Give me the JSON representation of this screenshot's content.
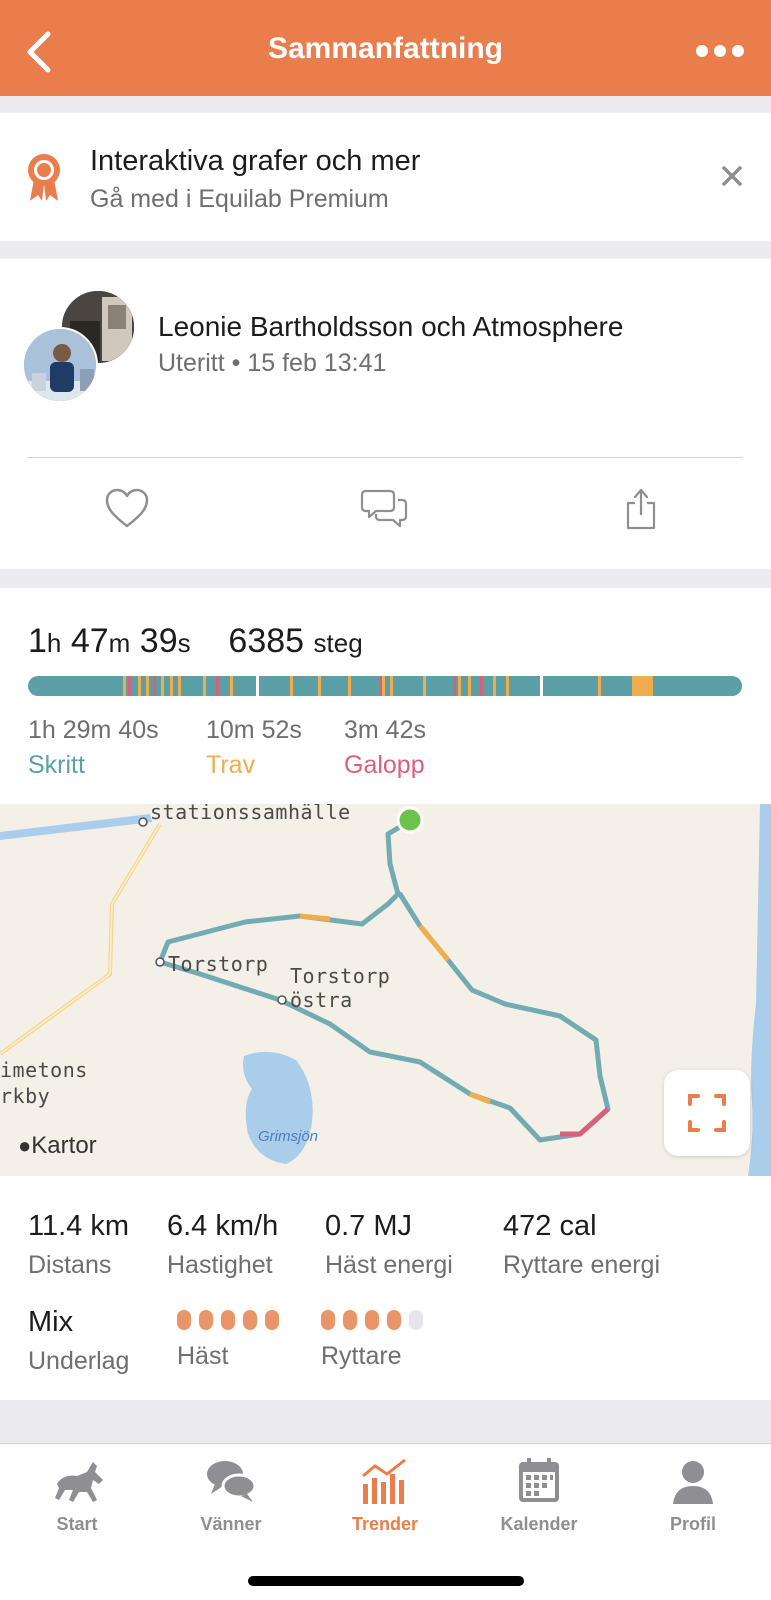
{
  "nav": {
    "title": "Sammanfattning"
  },
  "premium": {
    "title": "Interaktiva grafer och mer",
    "subtitle": "Gå med i Equilab Premium"
  },
  "activity": {
    "name": "Leonie Bartholdsson och Atmosphere",
    "type": "Uteritt",
    "separator": "•",
    "datetime": "15 feb 13:41"
  },
  "gait": {
    "total": {
      "h": "1",
      "h_unit": "h",
      "m": "47",
      "m_unit": "m",
      "s": "39",
      "s_unit": "s"
    },
    "steps": "6385",
    "steps_unit": "steg",
    "items": [
      {
        "time": "1h 29m 40s",
        "label": "Skritt",
        "color": "#5b9fa7"
      },
      {
        "time": "10m 52s",
        "label": "Trav",
        "color": "#f0ad4e"
      },
      {
        "time": "3m 42s",
        "label": "Galopp",
        "color": "#d9607a"
      }
    ]
  },
  "map": {
    "labels": [
      "stationssamhälle",
      "Torstorp",
      "Torstorp",
      "östra",
      "imetons",
      "rkby",
      "Grimsjön"
    ],
    "brand": "Kartor"
  },
  "stats": {
    "distance": {
      "value": "11.4 km",
      "label": "Distans"
    },
    "speed": {
      "value": "6.4 km/h",
      "label": "Hastighet"
    },
    "horse_energy": {
      "value": "0.7 MJ",
      "label": "Häst energi"
    },
    "rider_energy": {
      "value": "472 cal",
      "label": "Ryttare energi"
    },
    "surface": {
      "value": "Mix",
      "label": "Underlag"
    },
    "horse_rating": {
      "value": 5,
      "max": 5,
      "label": "Häst"
    },
    "rider_rating": {
      "value": 4,
      "max": 5,
      "label": "Ryttare"
    }
  },
  "tabs": [
    {
      "label": "Start",
      "icon": "horse-icon"
    },
    {
      "label": "Vänner",
      "icon": "chat-icon"
    },
    {
      "label": "Trender",
      "icon": "trend-icon",
      "active": true
    },
    {
      "label": "Kalender",
      "icon": "calendar-icon"
    },
    {
      "label": "Profil",
      "icon": "profile-icon"
    }
  ],
  "colors": {
    "accent": "#e97e4c",
    "walk": "#5b9fa7",
    "trot": "#f0ad4e",
    "canter": "#d9607a"
  }
}
